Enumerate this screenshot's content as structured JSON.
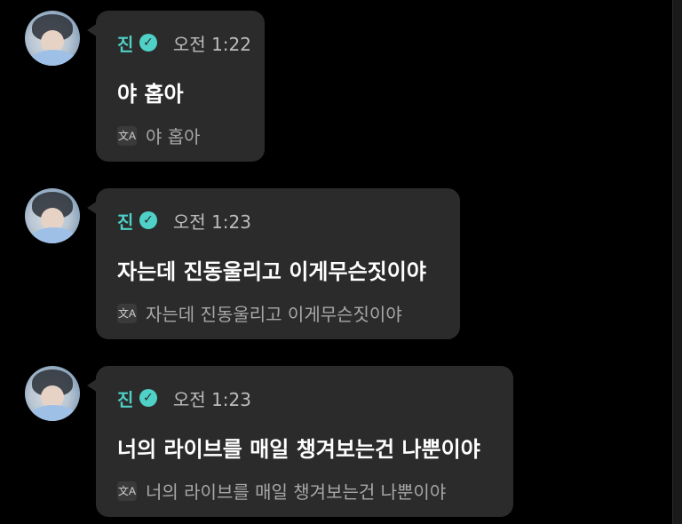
{
  "messages": [
    {
      "sender": "진",
      "time": "오전 1:22",
      "text": "야 홉아",
      "translation": "야 홉아"
    },
    {
      "sender": "진",
      "time": "오전 1:23",
      "text": "자는데 진동울리고 이게무슨짓이야",
      "translation": "자는데 진동울리고 이게무슨짓이야"
    },
    {
      "sender": "진",
      "time": "오전 1:23",
      "text": "너의 라이브를 매일 챙겨보는건 나뿐이야",
      "translation": "너의 라이브를 매일 챙겨보는건 나뿐이야"
    }
  ],
  "icons": {
    "verified": "verified-check-icon",
    "translate": "translate-icon"
  },
  "colors": {
    "background": "#000000",
    "bubble": "#2b2b2b",
    "accent": "#4fd1c7",
    "time": "#bdbdbd",
    "translation_text": "#a7a7a7"
  }
}
